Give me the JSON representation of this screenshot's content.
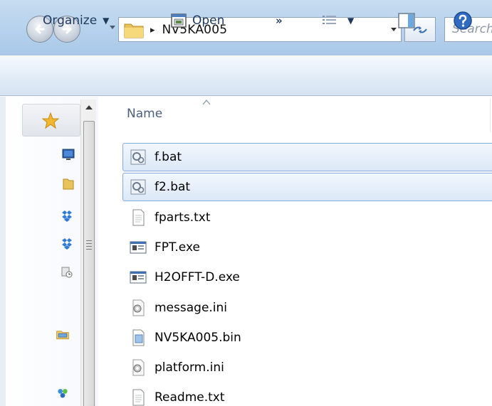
{
  "window": {
    "address": {
      "path_segment": "NV5KA005",
      "crumb_glyph": "▸"
    },
    "search": {
      "placeholder": "Search"
    },
    "icons": {
      "back": "back-arrow-icon",
      "forward": "forward-arrow-icon",
      "refresh": "refresh-icon"
    }
  },
  "toolbar": {
    "organize_label": "Organize",
    "organize_caret": "▼",
    "open_label": "Open",
    "more_label": "»",
    "views_caret": "▼"
  },
  "navpane": {
    "items": [
      {
        "icon": "star-favorites-icon"
      },
      {
        "icon": "desktop-icon"
      },
      {
        "icon": "folder-icon"
      },
      {
        "icon": "dropbox-icon"
      },
      {
        "icon": "dropbox-icon"
      },
      {
        "icon": "recent-places-icon"
      },
      {
        "icon": "libraries-icon"
      },
      {
        "icon": "homegroup-icon"
      }
    ]
  },
  "filelist": {
    "column_header": "Name",
    "files": [
      {
        "name": "f.bat",
        "type": "batch",
        "selected": true
      },
      {
        "name": "f2.bat",
        "type": "batch",
        "selected": true
      },
      {
        "name": "fparts.txt",
        "type": "text",
        "selected": false
      },
      {
        "name": "FPT.exe",
        "type": "exe",
        "selected": false
      },
      {
        "name": "H2OFFT-D.exe",
        "type": "exe",
        "selected": false
      },
      {
        "name": "message.ini",
        "type": "ini",
        "selected": false
      },
      {
        "name": "NV5KA005.bin",
        "type": "bin",
        "selected": false
      },
      {
        "name": "platform.ini",
        "type": "ini",
        "selected": false
      },
      {
        "name": "Readme.txt",
        "type": "text",
        "selected": false
      }
    ]
  },
  "colors": {
    "toolbar_text": "#1e395b",
    "selection_border": "#84acdd",
    "header_text": "#4c607a"
  }
}
